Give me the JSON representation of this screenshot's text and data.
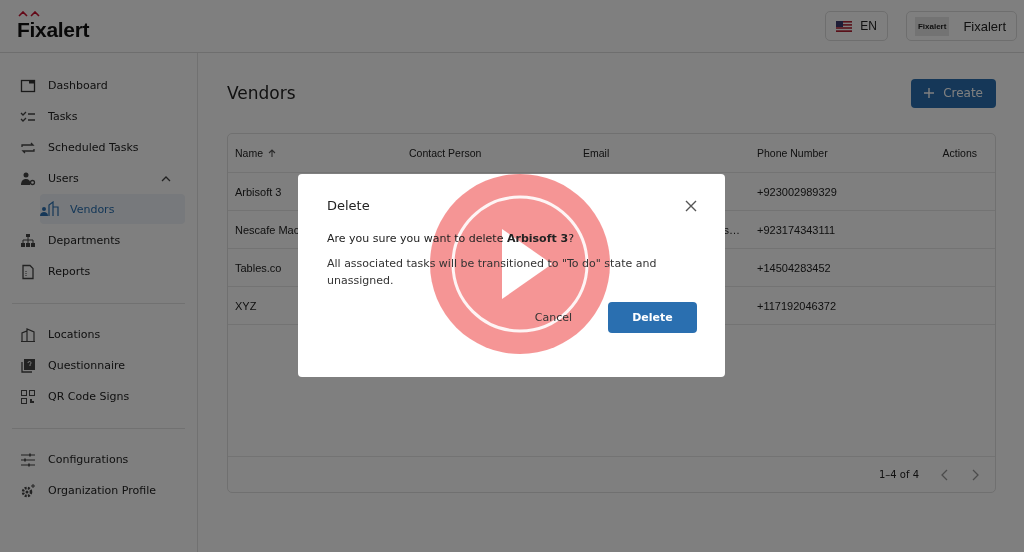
{
  "header": {
    "logo": "Fixalert",
    "language": {
      "label": "EN"
    },
    "organization": {
      "logo_text": "Fixalert",
      "name": "Fixalert"
    }
  },
  "sidebar": {
    "groups": [
      {
        "items": [
          {
            "label": "Dashboard",
            "selected": false
          },
          {
            "label": "Tasks",
            "selected": false
          },
          {
            "label": "Scheduled Tasks",
            "selected": false
          },
          {
            "label": "Users",
            "selected": false,
            "expanded": true,
            "children": [
              {
                "label": "Vendors",
                "selected": true
              }
            ]
          },
          {
            "label": "Departments",
            "selected": false
          },
          {
            "label": "Reports",
            "selected": false
          }
        ]
      },
      {
        "items": [
          {
            "label": "Locations",
            "selected": false
          },
          {
            "label": "Questionnaire",
            "selected": false
          },
          {
            "label": "QR Code Signs",
            "selected": false
          }
        ]
      },
      {
        "items": [
          {
            "label": "Configurations",
            "selected": false
          },
          {
            "label": "Organization Profile",
            "selected": false
          }
        ]
      }
    ]
  },
  "page": {
    "title": "Vendors",
    "create_button": "Create"
  },
  "table": {
    "columns": [
      {
        "label": "Name",
        "sorted": true
      },
      {
        "label": "Contact Person",
        "sorted": false
      },
      {
        "label": "Email",
        "sorted": false
      },
      {
        "label": "Phone Number",
        "sorted": false
      },
      {
        "label": "Actions",
        "sorted": false
      }
    ],
    "rows": [
      [
        "Arbisoft 3",
        "",
        "",
        "+923002989329",
        ""
      ],
      [
        "Nescafe Mac",
        "",
        "s…",
        "+923174343111",
        ""
      ],
      [
        "Tables.co",
        "",
        "",
        "+14504283452",
        ""
      ],
      [
        "XYZ",
        "",
        "",
        "+117192046372",
        ""
      ]
    ],
    "pagination": "1–4 of 4"
  },
  "dialog": {
    "title": "Delete",
    "message": "Are you sure you want to delete **Arbisoft 3**?",
    "detail": "All associated tasks will be transitioned to \"To do\" state and unassigned.",
    "buttons": [
      {
        "label": "Cancel",
        "kind": "text"
      },
      {
        "label": "Delete",
        "kind": "primary"
      }
    ]
  }
}
